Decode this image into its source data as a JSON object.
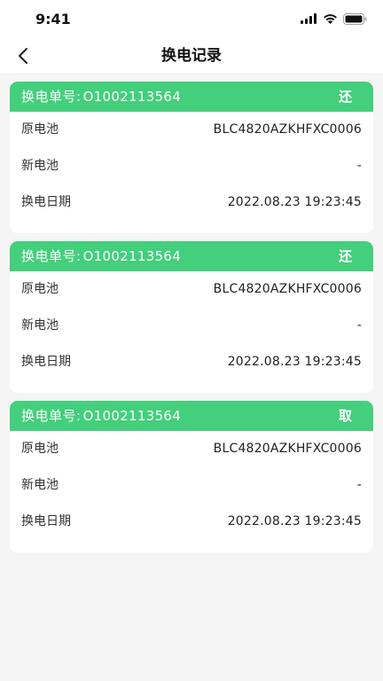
{
  "status_bar": {
    "time": "9:41"
  },
  "nav": {
    "title": "换电记录"
  },
  "cards": [
    {
      "order_label": "换电单号:",
      "order_no": "O1002113564",
      "action": "还",
      "rows": [
        {
          "label": "原电池",
          "value": "BLC4820AZKHFXC0006"
        },
        {
          "label": "新电池",
          "value": "-"
        },
        {
          "label": "换电日期",
          "value": "2022.08.23 19:23:45"
        }
      ]
    },
    {
      "order_label": "换电单号:",
      "order_no": "O1002113564",
      "action": "还",
      "rows": [
        {
          "label": "原电池",
          "value": "BLC4820AZKHFXC0006"
        },
        {
          "label": "新电池",
          "value": "-"
        },
        {
          "label": "换电日期",
          "value": "2022.08.23 19:23:45"
        }
      ]
    },
    {
      "order_label": "换电单号:",
      "order_no": "O1002113564",
      "action": "取",
      "rows": [
        {
          "label": "原电池",
          "value": "BLC4820AZKHFXC0006"
        },
        {
          "label": "新电池",
          "value": "-"
        },
        {
          "label": "换电日期",
          "value": "2022.08.23 19:23:45"
        }
      ]
    }
  ],
  "colors": {
    "accent": "#43cf7c",
    "background": "#f5f5f5",
    "card": "#ffffff"
  },
  "icons": {
    "back": "chevron-left-icon",
    "signal": "cellular-signal-icon",
    "wifi": "wifi-icon",
    "battery": "battery-icon"
  }
}
